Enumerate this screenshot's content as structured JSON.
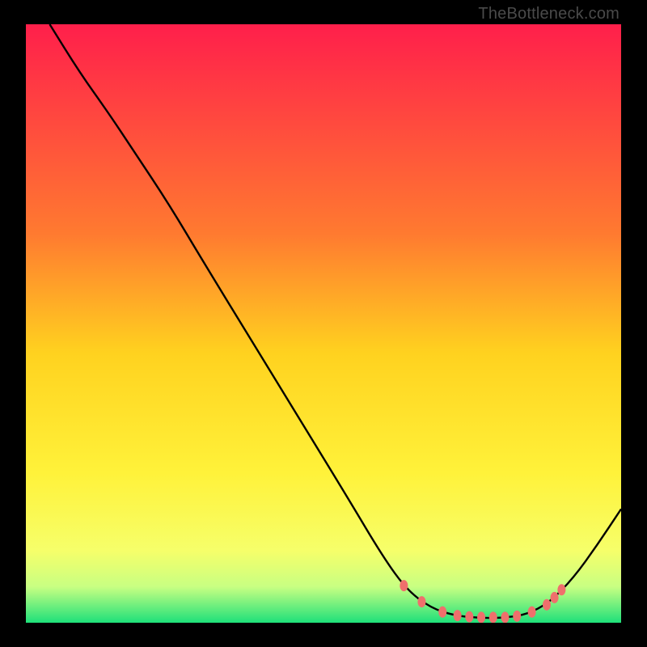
{
  "watermark": "TheBottleneck.com",
  "chart_data": {
    "type": "line",
    "title": "",
    "xlabel": "",
    "ylabel": "",
    "xlim": [
      0,
      100
    ],
    "ylim": [
      0,
      100
    ],
    "gradient_stops": [
      {
        "offset": 0,
        "color": "#ff1f4b"
      },
      {
        "offset": 35,
        "color": "#ff7a30"
      },
      {
        "offset": 55,
        "color": "#ffd21f"
      },
      {
        "offset": 75,
        "color": "#fff23a"
      },
      {
        "offset": 88,
        "color": "#f6ff6a"
      },
      {
        "offset": 94,
        "color": "#c8ff82"
      },
      {
        "offset": 100,
        "color": "#1ee07a"
      }
    ],
    "series": [
      {
        "name": "curve",
        "color": "#000000",
        "points": [
          {
            "x": 4,
            "y": 100
          },
          {
            "x": 9,
            "y": 92
          },
          {
            "x": 14,
            "y": 85
          },
          {
            "x": 18,
            "y": 79
          },
          {
            "x": 24,
            "y": 70
          },
          {
            "x": 30,
            "y": 60
          },
          {
            "x": 38,
            "y": 47
          },
          {
            "x": 46,
            "y": 34
          },
          {
            "x": 54,
            "y": 21
          },
          {
            "x": 60,
            "y": 11
          },
          {
            "x": 64,
            "y": 5.5
          },
          {
            "x": 68,
            "y": 2.5
          },
          {
            "x": 72,
            "y": 1.2
          },
          {
            "x": 76,
            "y": 0.8
          },
          {
            "x": 80,
            "y": 0.8
          },
          {
            "x": 84,
            "y": 1.3
          },
          {
            "x": 88,
            "y": 3.4
          },
          {
            "x": 92,
            "y": 7.5
          },
          {
            "x": 96,
            "y": 13
          },
          {
            "x": 100,
            "y": 19
          }
        ]
      }
    ],
    "dot_markers": {
      "color": "#ef6f6c",
      "rx": 5,
      "ry": 7,
      "points": [
        {
          "x": 63.5,
          "y": 6.2
        },
        {
          "x": 66.5,
          "y": 3.5
        },
        {
          "x": 70.0,
          "y": 1.8
        },
        {
          "x": 72.5,
          "y": 1.2
        },
        {
          "x": 74.5,
          "y": 1.0
        },
        {
          "x": 76.5,
          "y": 0.9
        },
        {
          "x": 78.5,
          "y": 0.9
        },
        {
          "x": 80.5,
          "y": 0.9
        },
        {
          "x": 82.5,
          "y": 1.1
        },
        {
          "x": 85.0,
          "y": 1.8
        },
        {
          "x": 87.5,
          "y": 3.0
        },
        {
          "x": 88.8,
          "y": 4.2
        },
        {
          "x": 90.0,
          "y": 5.5
        }
      ]
    }
  }
}
